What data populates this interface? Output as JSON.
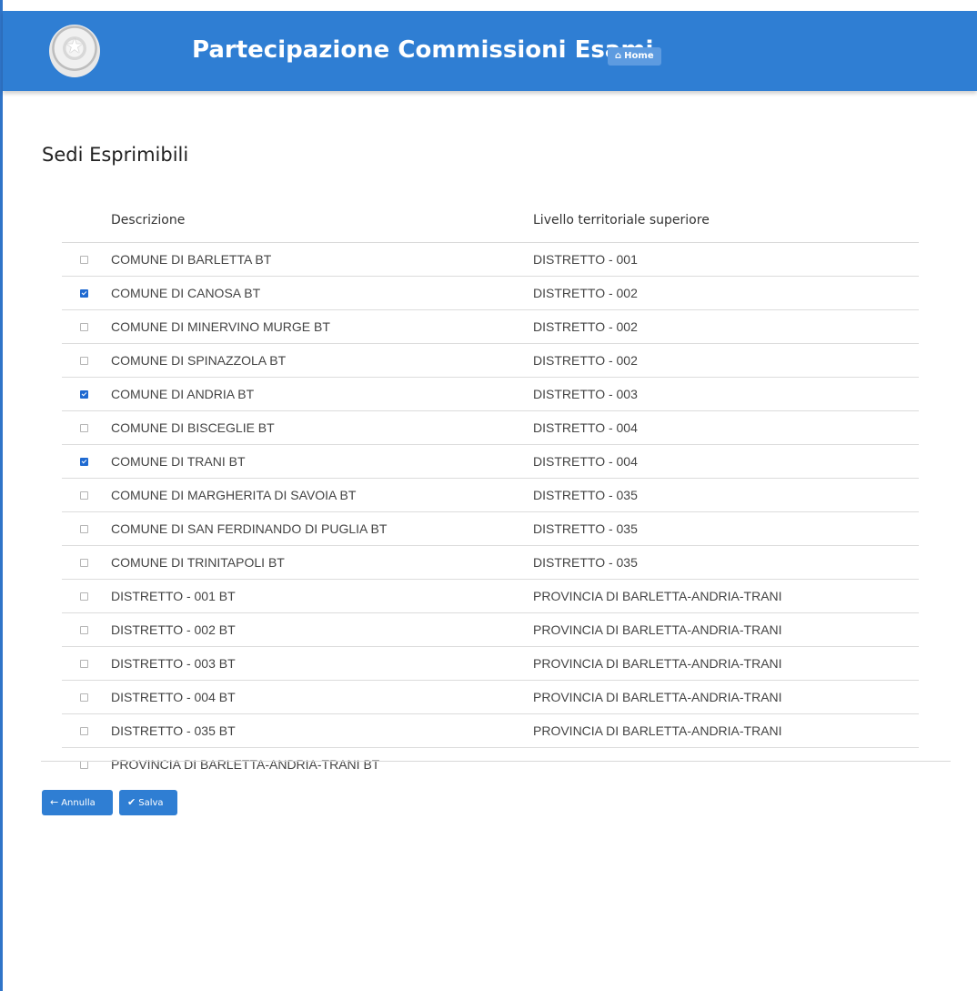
{
  "header": {
    "title": "Partecipazione Commissioni Esami",
    "home_label": "Home",
    "emblem_icon": "italian-republic-emblem",
    "home_icon": "home-icon",
    "background_color": "#2f7ed3"
  },
  "section": {
    "title": "Sedi Esprimibili"
  },
  "table": {
    "columns": [
      "Descrizione",
      "Livello territoriale superiore"
    ],
    "rows": [
      {
        "checked": false,
        "descrizione": "COMUNE DI BARLETTA BT",
        "livello": "DISTRETTO - 001"
      },
      {
        "checked": true,
        "descrizione": "COMUNE DI CANOSA BT",
        "livello": "DISTRETTO - 002"
      },
      {
        "checked": false,
        "descrizione": "COMUNE DI MINERVINO MURGE BT",
        "livello": "DISTRETTO - 002"
      },
      {
        "checked": false,
        "descrizione": "COMUNE DI SPINAZZOLA BT",
        "livello": "DISTRETTO - 002"
      },
      {
        "checked": true,
        "descrizione": "COMUNE DI ANDRIA BT",
        "livello": "DISTRETTO - 003"
      },
      {
        "checked": false,
        "descrizione": "COMUNE DI BISCEGLIE BT",
        "livello": "DISTRETTO - 004"
      },
      {
        "checked": true,
        "descrizione": "COMUNE DI TRANI BT",
        "livello": "DISTRETTO - 004"
      },
      {
        "checked": false,
        "descrizione": "COMUNE DI MARGHERITA DI SAVOIA BT",
        "livello": "DISTRETTO - 035"
      },
      {
        "checked": false,
        "descrizione": "COMUNE DI SAN FERDINANDO DI PUGLIA BT",
        "livello": "DISTRETTO - 035"
      },
      {
        "checked": false,
        "descrizione": "COMUNE DI TRINITAPOLI BT",
        "livello": "DISTRETTO - 035"
      },
      {
        "checked": false,
        "descrizione": "DISTRETTO - 001 BT",
        "livello": "PROVINCIA DI BARLETTA-ANDRIA-TRANI"
      },
      {
        "checked": false,
        "descrizione": "DISTRETTO - 002 BT",
        "livello": "PROVINCIA DI BARLETTA-ANDRIA-TRANI"
      },
      {
        "checked": false,
        "descrizione": "DISTRETTO - 003 BT",
        "livello": "PROVINCIA DI BARLETTA-ANDRIA-TRANI"
      },
      {
        "checked": false,
        "descrizione": "DISTRETTO - 004 BT",
        "livello": "PROVINCIA DI BARLETTA-ANDRIA-TRANI"
      },
      {
        "checked": false,
        "descrizione": "DISTRETTO - 035 BT",
        "livello": "PROVINCIA DI BARLETTA-ANDRIA-TRANI"
      },
      {
        "checked": false,
        "descrizione": "PROVINCIA DI BARLETTA-ANDRIA-TRANI BT",
        "livello": ""
      }
    ]
  },
  "actions": {
    "annulla_label": "Annulla",
    "salva_label": "Salva",
    "annulla_icon": "arrow-left-icon",
    "salva_icon": "check-icon"
  }
}
